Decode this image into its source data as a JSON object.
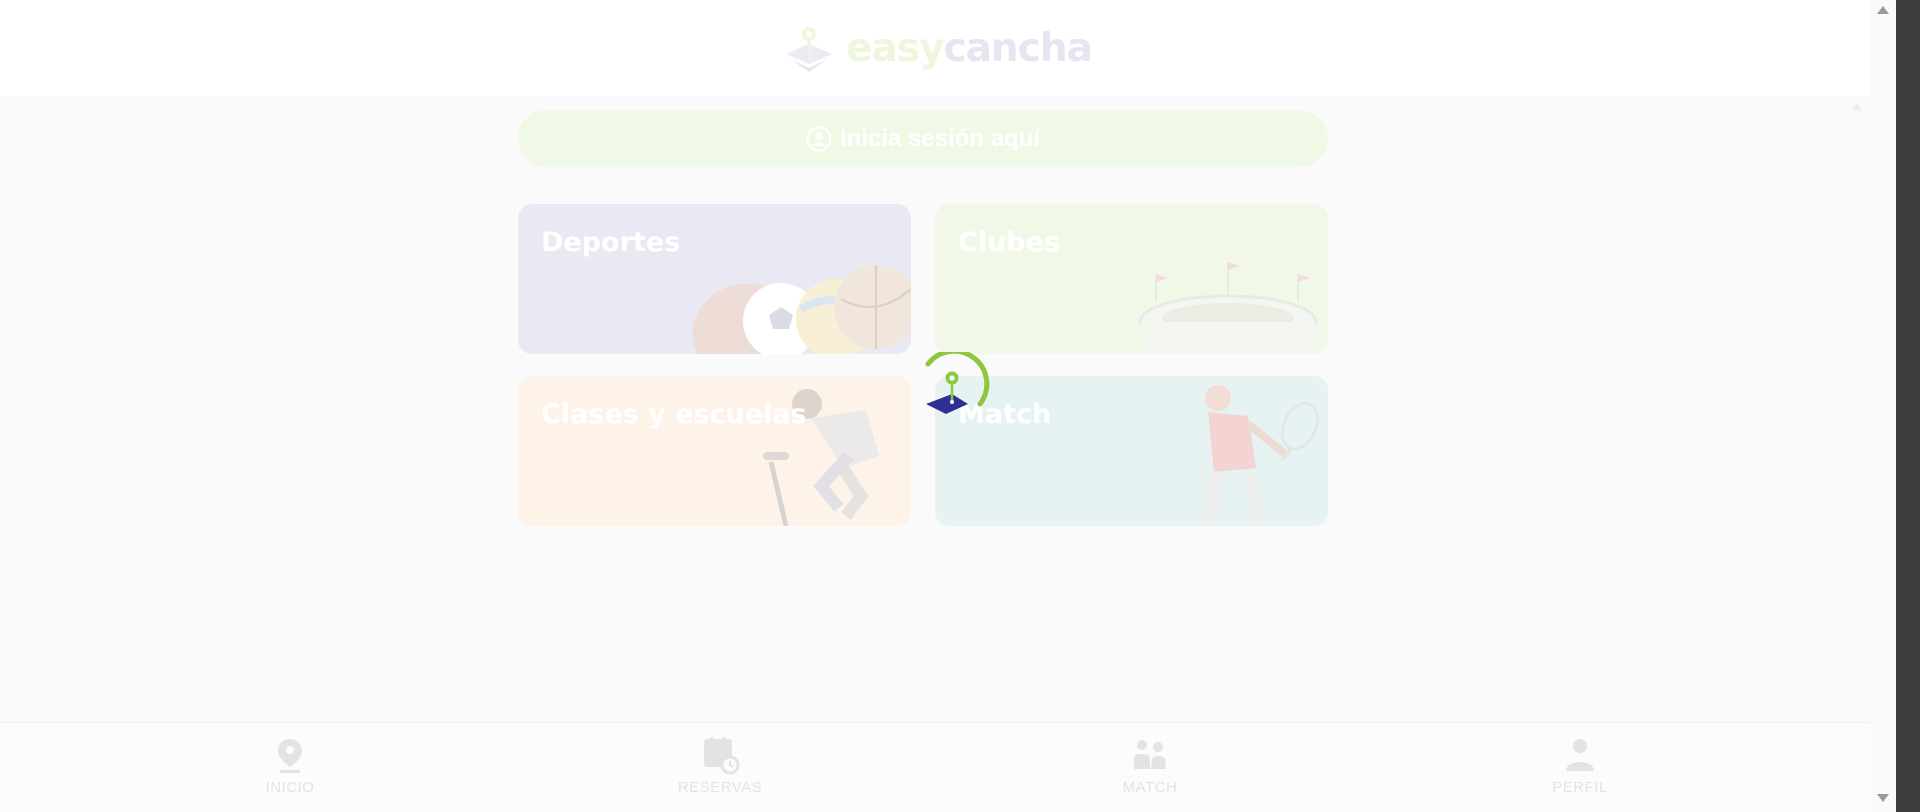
{
  "brand": {
    "name_part1": "easy",
    "name_part2": "cancha",
    "accent": "#8dc63f",
    "primary": "#2e3192"
  },
  "login": {
    "label": "Inicia sesión aquí",
    "icon": "user-circle-icon"
  },
  "cards": {
    "deportes": {
      "title": "Deportes",
      "color": "#e8e9f2"
    },
    "clubes": {
      "title": "Clubes",
      "color": "#f1f8e8"
    },
    "clases": {
      "title": "Clases y escuelas",
      "color": "#fef3e9"
    },
    "match": {
      "title": "Match",
      "color": "#e7f3f2"
    }
  },
  "loading": {
    "icon": "spinner-logo-icon"
  },
  "nav": {
    "inicio": {
      "label": "INICIO",
      "icon": "location-pin-icon"
    },
    "reservas": {
      "label": "RESERVAS",
      "icon": "calendar-clock-icon"
    },
    "match": {
      "label": "MATCH",
      "icon": "people-icon"
    },
    "perfil": {
      "label": "PERFIL",
      "icon": "user-icon"
    }
  }
}
